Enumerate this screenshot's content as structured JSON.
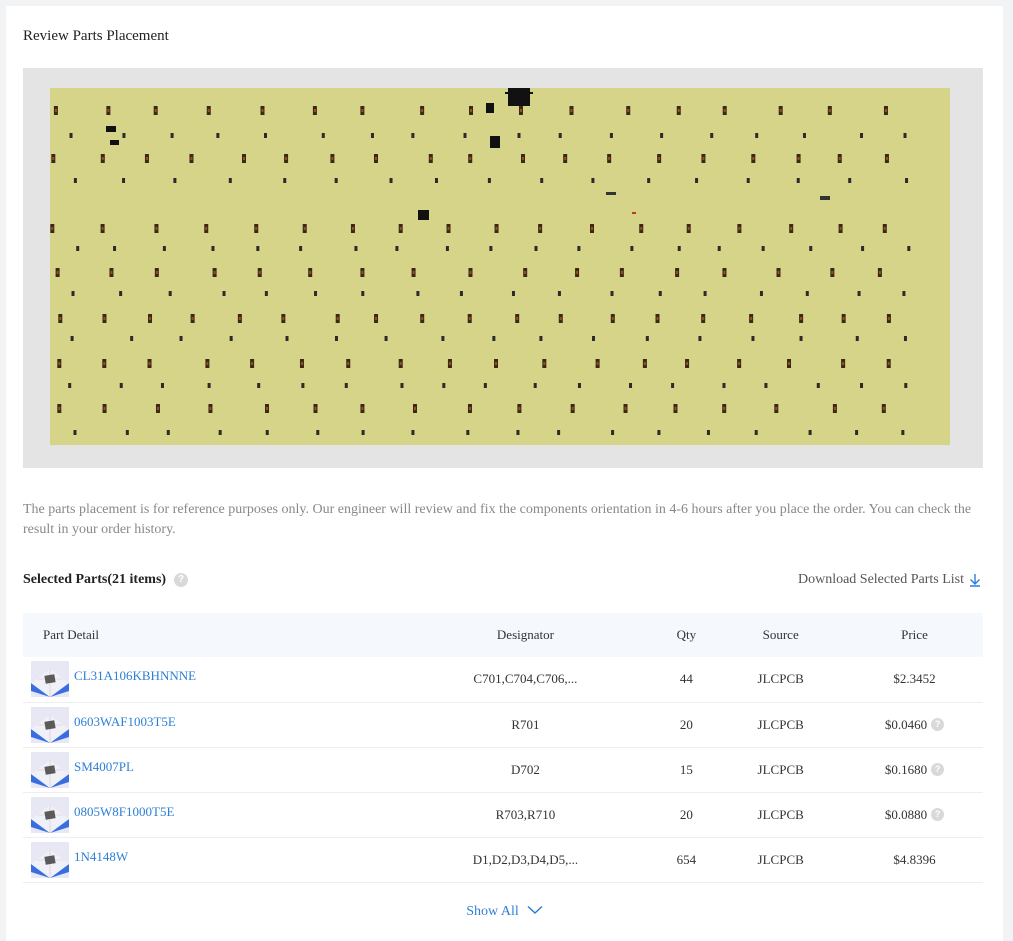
{
  "section": {
    "title": "Review Parts Placement"
  },
  "note": "The parts placement is for reference purposes only. Our engineer will review and fix the components orientation in 4-6 hours after you place the order. You can check the result in your order history.",
  "selected_parts": {
    "label": "Selected Parts(21 items)",
    "download_label": "Download Selected Parts List"
  },
  "table": {
    "headers": [
      "Part Detail",
      "Designator",
      "Qty",
      "Source",
      "Price"
    ],
    "rows": [
      {
        "part": "CL31A106KBHNNNE",
        "designator": "C701,C704,C706,...",
        "qty": "44",
        "source": "JLCPCB",
        "price": "$2.3452",
        "price_help": false
      },
      {
        "part": "0603WAF1003T5E",
        "designator": "R701",
        "qty": "20",
        "source": "JLCPCB",
        "price": "$0.0460",
        "price_help": true
      },
      {
        "part": "SM4007PL",
        "designator": "D702",
        "qty": "15",
        "source": "JLCPCB",
        "price": "$0.1680",
        "price_help": true
      },
      {
        "part": "0805W8F1000T5E",
        "designator": "R703,R710",
        "qty": "20",
        "source": "JLCPCB",
        "price": "$0.0880",
        "price_help": true
      },
      {
        "part": "1N4148W",
        "designator": "D1,D2,D3,D4,D5,...",
        "qty": "654",
        "source": "JLCPCB",
        "price": "$4.8396",
        "price_help": false
      }
    ]
  },
  "show_all": "Show All",
  "icons": {
    "help": "question-circle-icon",
    "download": "download-arrow-icon",
    "chevron": "chevron-down-icon"
  },
  "colors": {
    "link": "#2d7fd6",
    "pcb_board": "#d6d489",
    "pcb_background": "#e4e4e4",
    "header_bg": "#f5f9fd"
  }
}
